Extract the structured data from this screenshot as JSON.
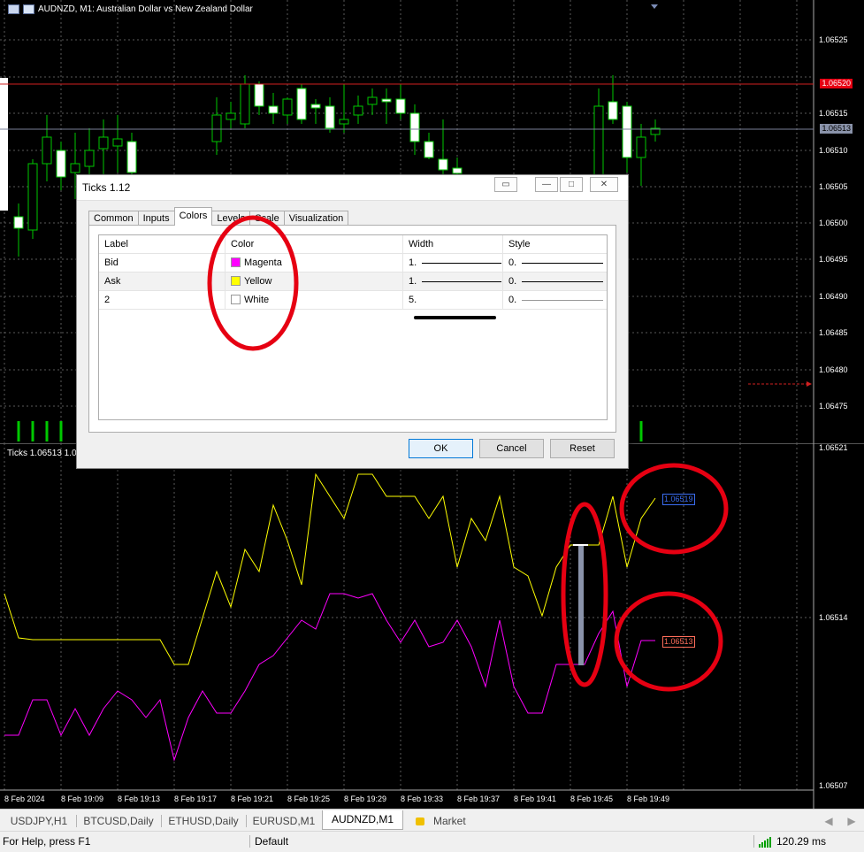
{
  "main_chart": {
    "title": "AUDNZD, M1:  Australian Dollar vs New Zealand Dollar",
    "price_labels": [
      "1.06525",
      "1.06520",
      "1.06515",
      "1.06510",
      "1.06505",
      "1.06500",
      "1.06495",
      "1.06490",
      "1.06485",
      "1.06480",
      "1.06475"
    ],
    "red_line_price": "1.06520",
    "current_price": "1.06513"
  },
  "sub_chart": {
    "title": "Ticks 1.06513 1.06",
    "price_labels": [
      "1.06521",
      "1.06514",
      "1.06507"
    ],
    "ask_label": "1.06519",
    "bid_label": "1.06513",
    "time_labels": [
      "8 Feb 2024",
      "8 Feb 19:09",
      "8 Feb 19:13",
      "8 Feb 19:17",
      "8 Feb 19:21",
      "8 Feb 19:25",
      "8 Feb 19:29",
      "8 Feb 19:33",
      "8 Feb 19:37",
      "8 Feb 19:41",
      "8 Feb 19:45",
      "8 Feb 19:49"
    ]
  },
  "dialog": {
    "title": "Ticks 1.12",
    "tabs": [
      "Common",
      "Inputs",
      "Colors",
      "Levels",
      "Scale",
      "Visualization"
    ],
    "active_tab": "Colors",
    "columns": [
      "Label",
      "Color",
      "Width",
      "Style"
    ],
    "rows": [
      {
        "label": "Bid",
        "color_name": "Magenta",
        "color": "#ff00ff",
        "width": "1.",
        "style": "0."
      },
      {
        "label": "Ask",
        "color_name": "Yellow",
        "color": "#ffff00",
        "width": "1.",
        "style": "0."
      },
      {
        "label": "2",
        "color_name": "White",
        "color": "#ffffff",
        "width": "5.",
        "style": "0."
      }
    ],
    "buttons": {
      "ok": "OK",
      "cancel": "Cancel",
      "reset": "Reset"
    }
  },
  "chart_tabs": [
    "USDJPY,H1",
    "BTCUSD,Daily",
    "ETHUSD,Daily",
    "EURUSD,M1",
    "AUDNZD,M1",
    "Market"
  ],
  "active_chart_tab": "AUDNZD,M1",
  "status": {
    "help": "For Help, press F1",
    "profile": "Default",
    "ping": "120.29 ms"
  },
  "colors": {
    "bull": "#00c800",
    "bid_line": "#ff00ff",
    "ask_line": "#ffff00",
    "annotation": "#e60012"
  }
}
